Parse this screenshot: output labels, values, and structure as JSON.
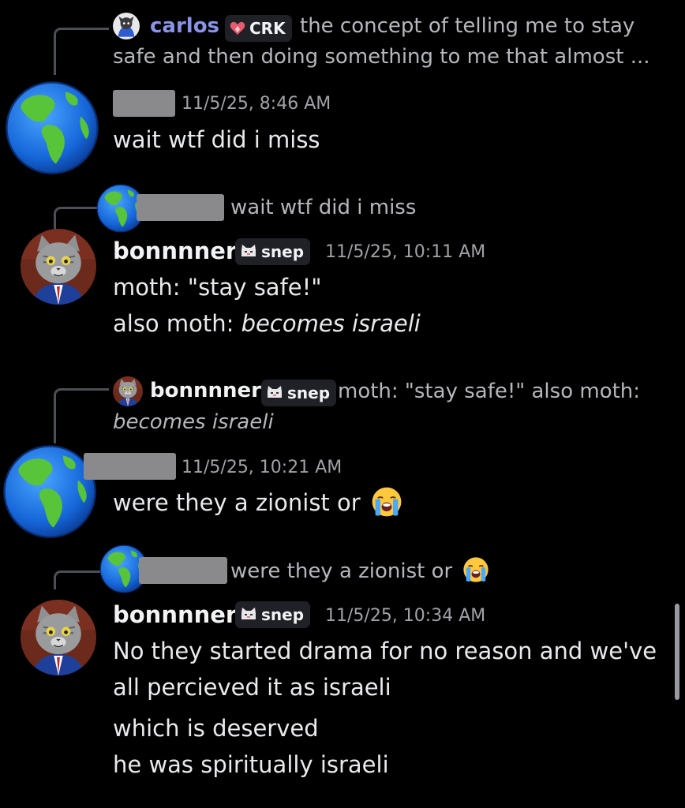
{
  "messages": [
    {
      "reply": {
        "author": "carlos",
        "badge": "CRK",
        "line1": "the concept of telling me to stay",
        "line2": "safe and then doing something to me that almost ..."
      },
      "timestamp": "11/5/25, 8:46 AM",
      "lines": [
        "wait wtf did i miss"
      ]
    },
    {
      "reply": {
        "text": "wait wtf did i miss"
      },
      "author": "bonnnner",
      "badge": "snep",
      "timestamp": "11/5/25, 10:11 AM",
      "lines": [
        "moth: \"stay safe!\"",
        "also moth: ",
        "becomes israeli"
      ]
    },
    {
      "reply": {
        "author": "bonnnner",
        "badge": "snep",
        "line1": "moth: \"stay safe!\" also moth:",
        "line2": "becomes israeli"
      },
      "timestamp": "11/5/25, 10:21 AM",
      "lines": [
        "were they a zionist or"
      ]
    },
    {
      "reply": {
        "text": "were they a zionist or"
      },
      "author": "bonnnner",
      "badge": "snep",
      "timestamp": "11/5/25, 10:34 AM",
      "lines": [
        "No they started drama for no reason and we've",
        "all percieved it as israeli",
        "which is deserved",
        "he was spiritually israeli"
      ]
    }
  ],
  "colors": {
    "background": "#000000",
    "link_name": "#8b93e6",
    "redaction": "#8a8a8c",
    "reply_line": "#4d4f56"
  },
  "icons": [
    "globe-avatar",
    "cat-avatar",
    "heart-badge-icon",
    "cat-badge-icon",
    "loudly-crying-emoji"
  ]
}
